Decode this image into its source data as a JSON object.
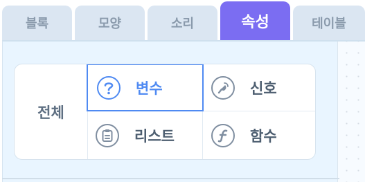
{
  "tabs": [
    {
      "label": "블록",
      "active": false
    },
    {
      "label": "모양",
      "active": false
    },
    {
      "label": "소리",
      "active": false
    },
    {
      "label": "속성",
      "active": true
    },
    {
      "label": "테이블",
      "active": false
    }
  ],
  "filter": {
    "all_label": "전체",
    "items": [
      {
        "label": "변수",
        "icon": "question-icon",
        "selected": true
      },
      {
        "label": "신호",
        "icon": "signal-icon",
        "selected": false
      },
      {
        "label": "리스트",
        "icon": "list-icon",
        "selected": false
      },
      {
        "label": "함수",
        "icon": "function-icon",
        "selected": false
      }
    ]
  },
  "colors": {
    "active_tab": "#7b6df2",
    "selected": "#4f8af2",
    "tab_bg": "#dbe6f2"
  }
}
